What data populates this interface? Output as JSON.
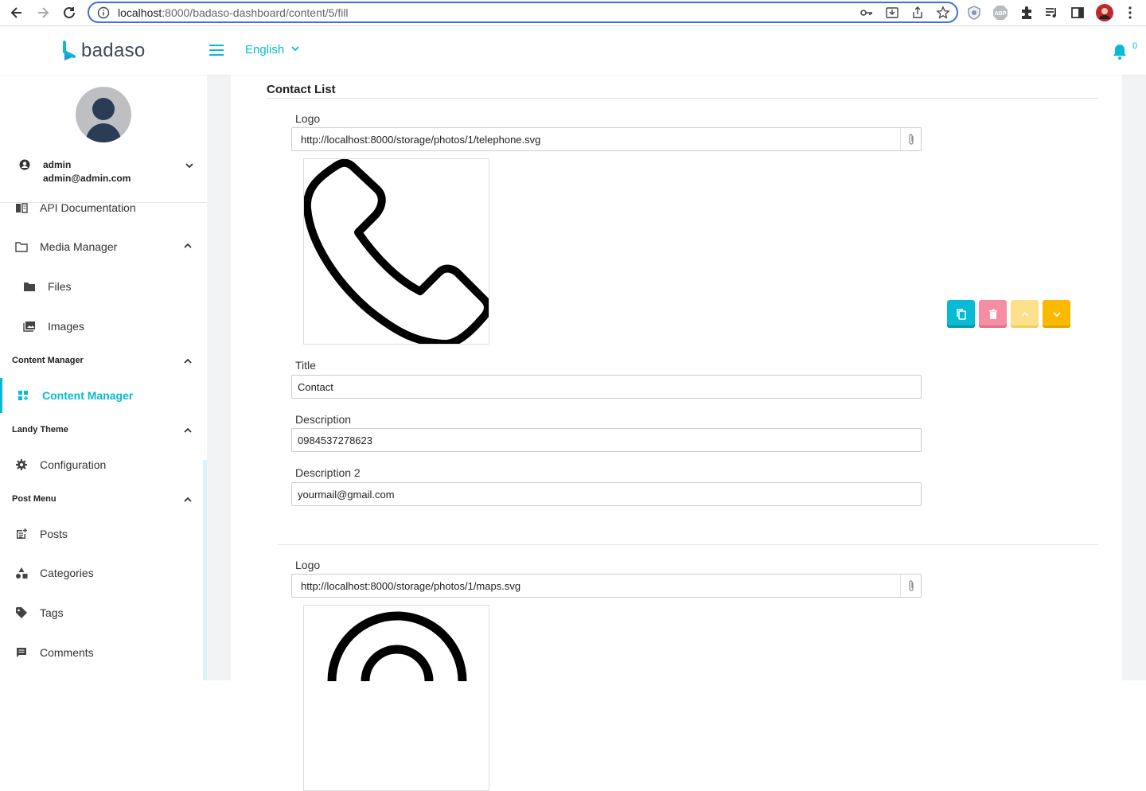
{
  "browser": {
    "url_host": "localhost",
    "url_path": ":8000/badaso-dashboard/content/5/fill"
  },
  "header": {
    "logo_text": "badaso",
    "language": "English",
    "notification_count": "0"
  },
  "user": {
    "name": "admin",
    "email": "admin@admin.com"
  },
  "sidebar": {
    "api_docs": "API Documentation",
    "media_manager": "Media Manager",
    "files": "Files",
    "images": "Images",
    "content_group": "Content Manager",
    "content_manager": "Content Manager",
    "landy_group": "Landy Theme",
    "configuration": "Configuration",
    "post_group": "Post Menu",
    "posts": "Posts",
    "categories": "Categories",
    "tags": "Tags",
    "comments": "Comments"
  },
  "main": {
    "section_title": "Contact List",
    "item1": {
      "logo_label": "Logo",
      "logo_value": "http://localhost:8000/storage/photos/1/telephone.svg",
      "title_label": "Title",
      "title_value": "Contact",
      "description_label": "Description",
      "description_value": "0984537278623",
      "description2_label": "Description 2",
      "description2_value": "yourmail@gmail.com"
    },
    "item2": {
      "logo_label": "Logo",
      "logo_value": "http://localhost:8000/storage/photos/1/maps.svg"
    }
  },
  "colors": {
    "accent": "#06bbd3",
    "danger": "#f58ea1",
    "warning_light": "#fde08a",
    "warning": "#fbb900"
  }
}
